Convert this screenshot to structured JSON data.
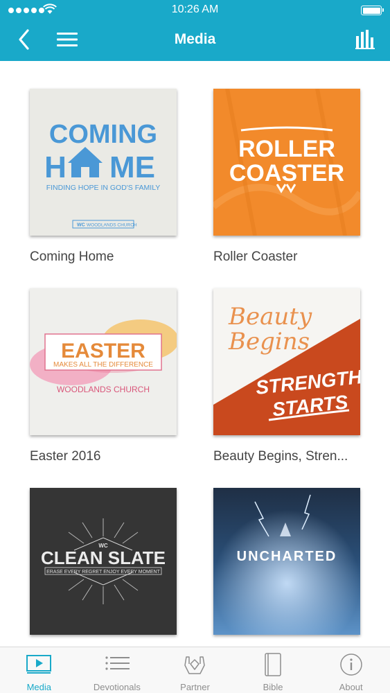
{
  "status_bar": {
    "time": "10:26 AM"
  },
  "nav": {
    "title": "Media"
  },
  "media_items": [
    {
      "title": "Coming Home",
      "cover_text": [
        "COMING",
        "H",
        "ME",
        "FINDING HOPE IN GOD'S FAMILY",
        "WC",
        "WOODLANDS CHURCH"
      ]
    },
    {
      "title": "Roller Coaster",
      "cover_text": [
        "ROLLER",
        "COASTER"
      ]
    },
    {
      "title": "Easter 2016",
      "cover_text": [
        "EASTER",
        "MAKES ALL THE DIFFERENCE",
        "WOODLANDS CHURCH"
      ]
    },
    {
      "title": "Beauty Begins, Stren...",
      "cover_text": [
        "Beauty",
        "Begins",
        "STRENGTH",
        "STARTS"
      ]
    },
    {
      "title": "",
      "cover_text": [
        "WC",
        "CLEAN SLATE",
        "ERASE EVERY REGRET ENJOY EVERY MOMENT"
      ]
    },
    {
      "title": "",
      "cover_text": [
        "UNCHARTED"
      ]
    }
  ],
  "tabs": [
    {
      "label": "Media",
      "active": true
    },
    {
      "label": "Devotionals"
    },
    {
      "label": "Partner"
    },
    {
      "label": "Bible"
    },
    {
      "label": "About"
    }
  ],
  "colors": {
    "accent": "#19a9c9",
    "tab_inactive": "#8e8e8e"
  }
}
